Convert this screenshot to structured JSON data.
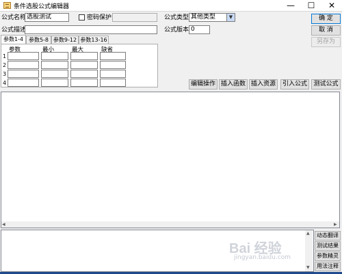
{
  "window": {
    "title": "条件选股公式编辑器",
    "minimize_glyph": "—",
    "maximize_glyph": "☐",
    "close_glyph": "✕"
  },
  "form": {
    "name_label": "公式名称",
    "name_value": "选股测试",
    "password_label": "密码保护",
    "password_checked": false,
    "desc_label": "公式描述",
    "desc_value": "",
    "type_label": "公式类型",
    "type_value": "其他类型",
    "version_label": "公式版本",
    "version_value": "0"
  },
  "buttons": {
    "ok": "确  定",
    "cancel": "取  消",
    "save_as": "另存为",
    "edit_op": "编辑操作",
    "insert_func": "插入函数",
    "insert_res": "插入资源",
    "import_formula": "引入公式",
    "test_formula": "测试公式"
  },
  "params": {
    "tabs": [
      "参数1-4",
      "参数5-8",
      "参数9-12",
      "参数13-16"
    ],
    "active_tab": 0,
    "headers": [
      "参数",
      "最小",
      "最大",
      "缺省"
    ],
    "rows": [
      "1",
      "2",
      "3",
      "4"
    ]
  },
  "side_buttons": [
    "动态翻译",
    "测试结果",
    "参数精灵",
    "用法注释"
  ],
  "watermark": {
    "text": "Bai 经验",
    "sub": "jingyan.baidu.com"
  },
  "icons": [
    "app-icon",
    "dropdown-arrow-icon",
    "scroll-left-icon",
    "scroll-right-icon",
    "scroll-up-icon",
    "scroll-down-icon"
  ]
}
